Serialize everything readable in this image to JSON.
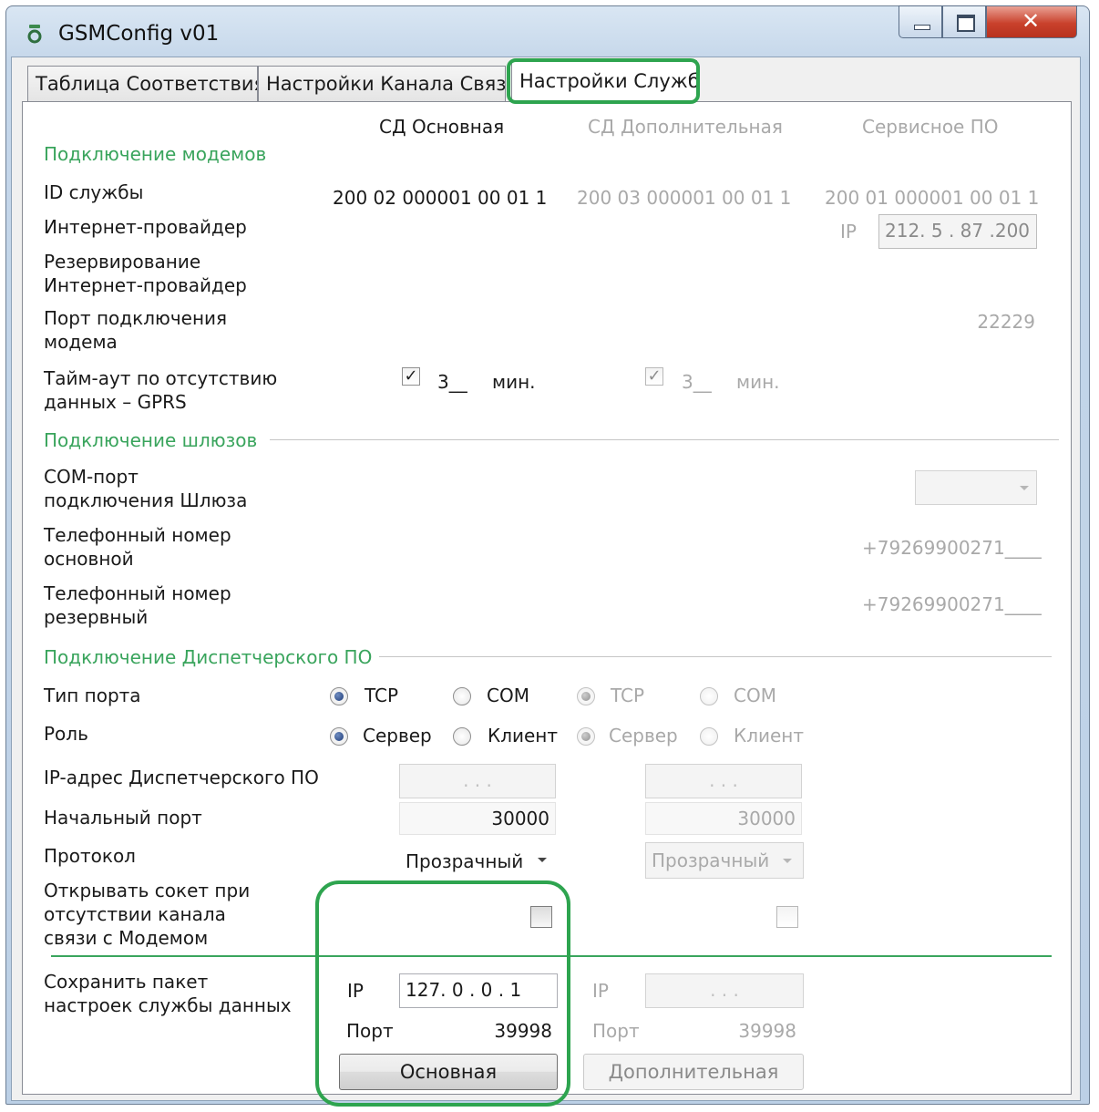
{
  "window": {
    "title": "GSMConfig v01"
  },
  "tabs": [
    {
      "label": "Таблица Соответствия"
    },
    {
      "label": "Настройки Канала Связи"
    },
    {
      "label": "Настройки Служб"
    }
  ],
  "columns": {
    "primary": "СД Основная",
    "additional": "СД Дополнительная",
    "service": "Сервисное ПО"
  },
  "sections": {
    "modems": "Подключение модемов",
    "gateways": "Подключение шлюзов",
    "dispatcher": "Подключение Диспетчерского ПО"
  },
  "labels": {
    "service_id": "ID службы",
    "isp": "Интернет-провайдер",
    "isp_reserve_1": "Резервирование",
    "isp_reserve_2": "Интернет-провайдер",
    "modem_port_1": "Порт подключения",
    "modem_port_2": "модема",
    "timeout_1": "Тайм-аут по отсутствию",
    "timeout_2": "данных – GPRS",
    "com_port_1": "COM-порт",
    "com_port_2": "подключения Шлюза",
    "phone_main_1": "Телефонный номер",
    "phone_main_2": "основной",
    "phone_reserve_1": "Телефонный номер",
    "phone_reserve_2": "резервный",
    "port_type": "Тип порта",
    "role": "Роль",
    "dispatcher_ip": "IP-адрес Диспетчерского ПО",
    "start_port": "Начальный порт",
    "protocol": "Протокол",
    "open_socket_1": "Открывать сокет при",
    "open_socket_2": "отсутствии канала",
    "open_socket_3": "связи с Модемом",
    "save_packet_1": "Сохранить пакет",
    "save_packet_2": "настроек службы данных"
  },
  "values": {
    "id_primary": "200 02 000001 00 01 1",
    "id_additional": "200 03 000001 00 01 1",
    "id_service": "200 01 000001 00 01 1",
    "isp_ip_label": "IP",
    "isp_ip": "212.  5  . 87 .200",
    "modem_port": "22229",
    "timeout_primary": "3__",
    "timeout_additional": "3__",
    "min_unit": "мин.",
    "phone_main": "+79269900271____",
    "phone_reserve": "+79269900271____",
    "tcp": "TCP",
    "com": "COM",
    "server": "Сервер",
    "client": "Клиент",
    "ip_empty": ".      .      .",
    "start_port_primary": "30000",
    "start_port_additional": "30000",
    "protocol_primary": "Прозрачный",
    "protocol_additional": "Прозрачный",
    "save_ip_label": "IP",
    "save_ip_primary": "127.  0  .  0  .  1",
    "save_port_label": "Порт",
    "save_port_primary": "39998",
    "save_port_additional": "39998",
    "btn_primary": "Основная",
    "btn_additional": "Дополнительная"
  },
  "colors": {
    "section": "#39a45c",
    "highlight": "#2ea44f"
  }
}
